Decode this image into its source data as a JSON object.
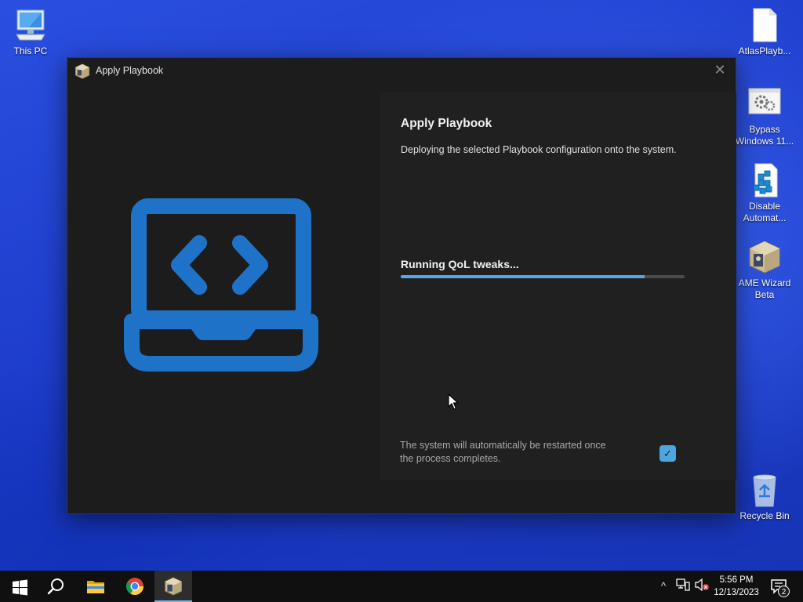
{
  "desktop": {
    "icons": [
      {
        "label": "This PC",
        "icon": "computer-icon"
      },
      {
        "label": "AtlasPlayb...",
        "icon": "document-icon"
      },
      {
        "label": "Bypass Windows 11...",
        "icon": "settings-script-icon"
      },
      {
        "label": "Disable Automat...",
        "icon": "registry-icon"
      },
      {
        "label": "AME Wizard Beta",
        "icon": "ame-wizard-icon"
      },
      {
        "label": "Recycle Bin",
        "icon": "recycle-bin-icon"
      }
    ]
  },
  "window": {
    "title": "Apply Playbook",
    "icon": "ame-wizard-icon",
    "close_label": "✕",
    "art_icon": "laptop-code-icon",
    "panel": {
      "title": "Apply Playbook",
      "description": "Deploying the selected Playbook configuration onto the system.",
      "status": "Running QoL tweaks...",
      "progress_percent": 86,
      "note": "The system will automatically be restarted once the process completes.",
      "restart_checked": true,
      "checkbox_glyph": "✓"
    }
  },
  "taskbar": {
    "buttons": [
      {
        "name": "start",
        "icon": "windows-logo-icon"
      },
      {
        "name": "search",
        "icon": "search-icon"
      },
      {
        "name": "file-explorer",
        "icon": "folder-icon"
      },
      {
        "name": "chrome",
        "icon": "chrome-icon"
      },
      {
        "name": "ame-wizard",
        "icon": "ame-wizard-icon",
        "active": true
      }
    ],
    "tray": {
      "chevron": "^",
      "clock_time": "5:56 PM",
      "clock_date": "12/13/2023",
      "notification_count": "2"
    }
  },
  "colors": {
    "accent": "#4fa6df",
    "progress": "#5aa6e6",
    "art_blue": "#1e73c8",
    "window_bg": "#1c1c1c",
    "panel_bg": "#202020",
    "taskbar_bg": "#101010"
  }
}
